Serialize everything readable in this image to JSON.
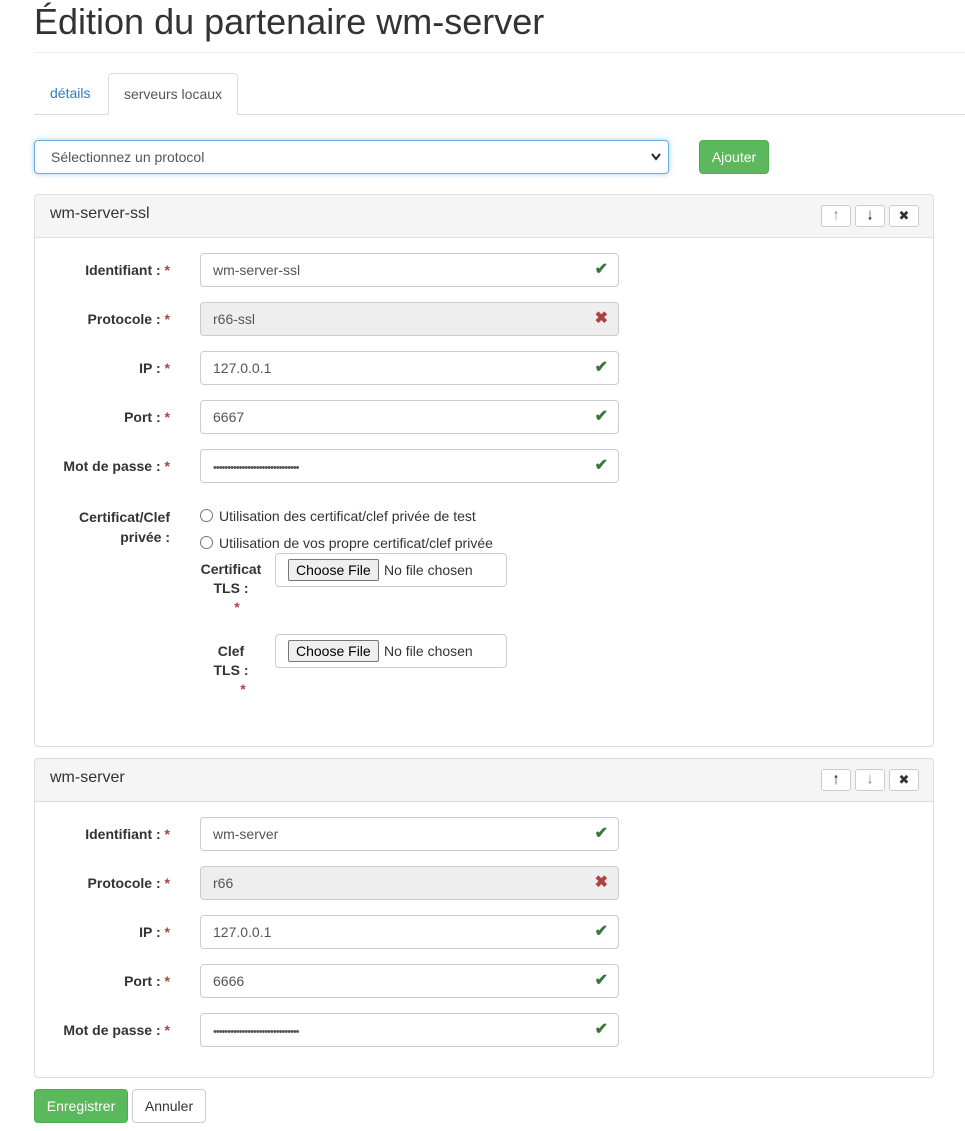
{
  "page": {
    "title": "Édition du partenaire wm-server"
  },
  "tabs": [
    {
      "label": "détails",
      "active": false
    },
    {
      "label": "serveurs locaux",
      "active": true
    }
  ],
  "add_bar": {
    "select_value": "Sélectionnez un protocol",
    "add_label": "Ajouter"
  },
  "colors": {
    "success": "#5cb85c",
    "link": "#337ab7",
    "error": "#a94442",
    "valid": "#3c763d",
    "focus": "#66afe9"
  },
  "labels": {
    "identifiant": "Identifiant :",
    "protocole": "Protocole :",
    "ip": "IP :",
    "port": "Port :",
    "password": "Mot de passe :",
    "cert_line1": "Certificat/Clef",
    "cert_line2": "privée :",
    "required": "*",
    "radio_test": "Utilisation des certificat/clef privée de test",
    "radio_own": "Utilisation de vos propre certificat/clef privée",
    "cert_tls_1": "Certificat",
    "cert_tls_2": "TLS :",
    "key_tls_1": "Clef",
    "key_tls_2": "TLS :",
    "choose_file": "Choose File",
    "no_file": "No file chosen"
  },
  "icons": {
    "valid": "check-icon",
    "invalid": "times-icon",
    "up": "arrow-up-icon",
    "down": "arrow-down-icon",
    "remove": "close-icon"
  },
  "servers": [
    {
      "title": "wm-server-ssl",
      "identifiant": "wm-server-ssl",
      "protocole": "r66-ssl",
      "ip": "127.0.0.1",
      "port": "6667",
      "password": "••••••••••••••••••••••••••••••"
    },
    {
      "title": "wm-server",
      "identifiant": "wm-server",
      "protocole": "r66",
      "ip": "127.0.0.1",
      "port": "6666",
      "password": "••••••••••••••••••••••••••••••"
    }
  ],
  "footer": {
    "save_label": "Enregistrer",
    "cancel_label": "Annuler"
  }
}
